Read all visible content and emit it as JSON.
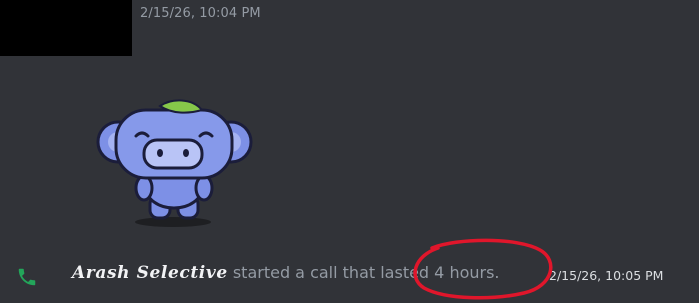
{
  "top_message": {
    "timestamp": "2/15/26, 10:04 PM",
    "sticker_icon": "wumpus-sticker-icon"
  },
  "call_message": {
    "icon": "phone-icon",
    "username": "Arash Selective",
    "text": "started a call that lasted 4 hours.",
    "timestamp": "2/15/26, 10:05 PM"
  },
  "annotation": {
    "icon": "red-circle-annotation-icon",
    "color": "#e0162b"
  },
  "colors": {
    "background": "#313338",
    "muted_text": "#949ba4",
    "call_green": "#23a55a",
    "username": "#f2f3f5"
  }
}
